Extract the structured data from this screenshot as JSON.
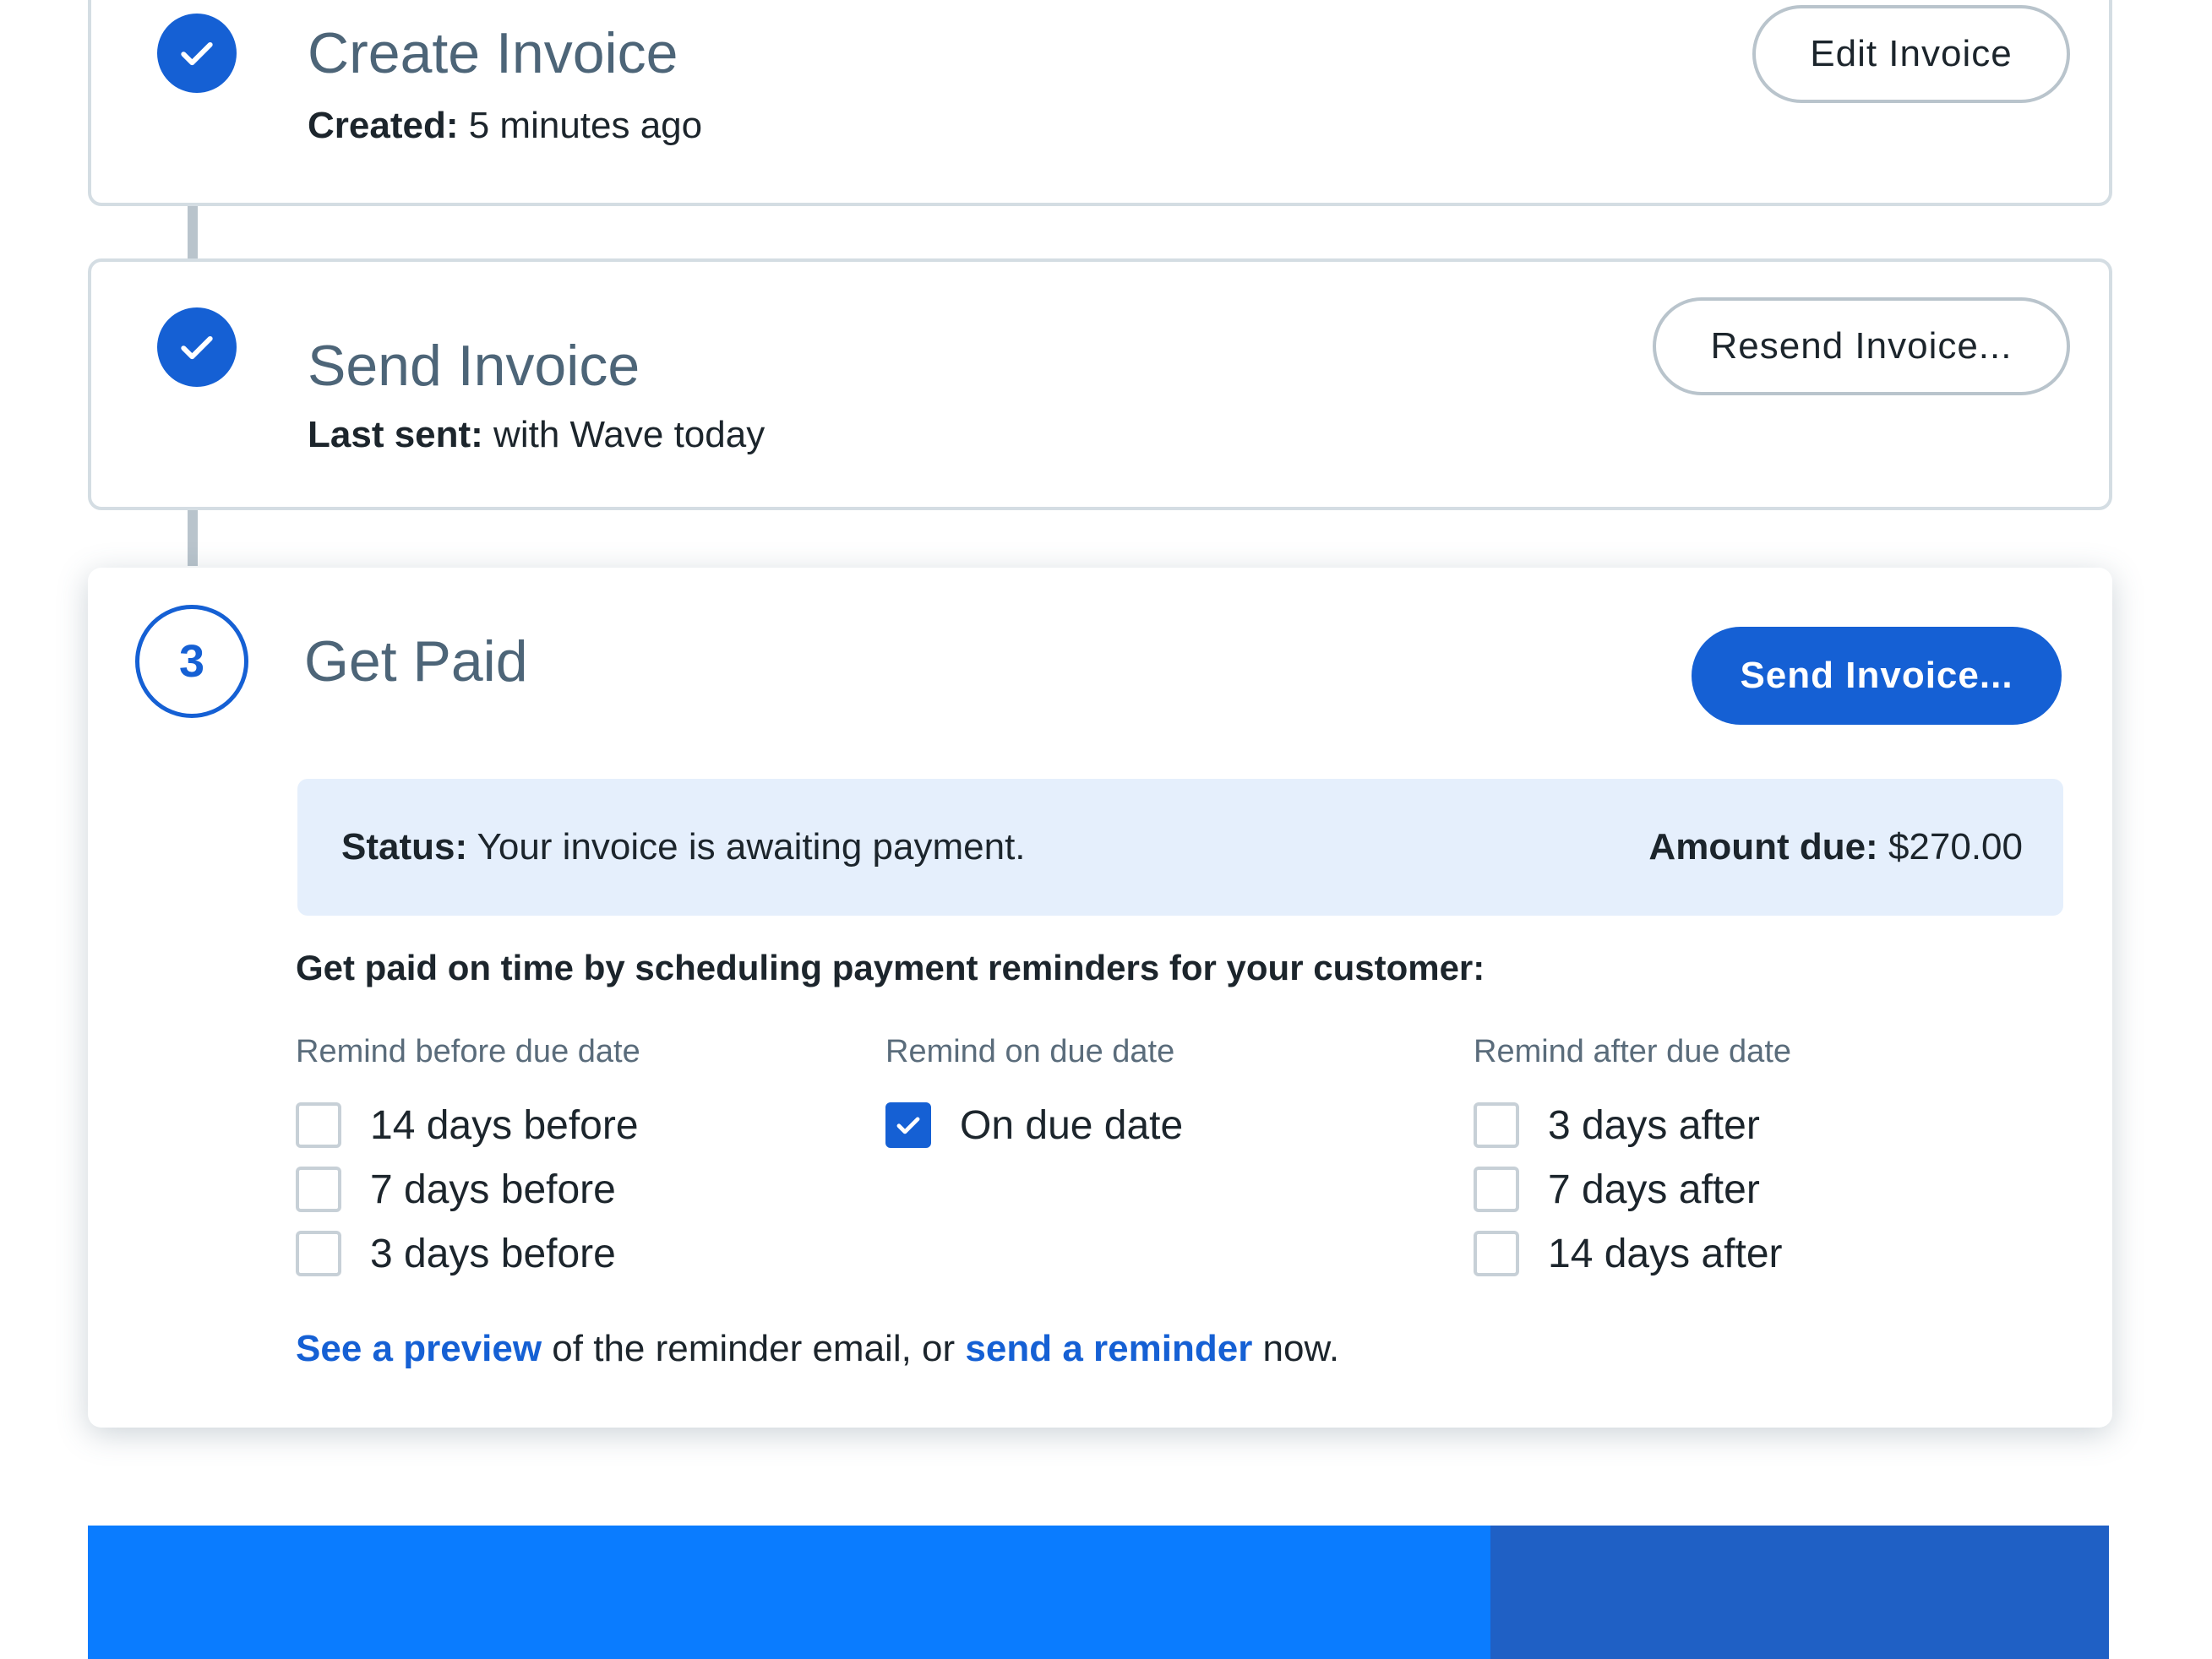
{
  "steps": [
    {
      "title": "Create Invoice",
      "meta_label": "Created:",
      "meta_value": " 5 minutes ago",
      "button": "Edit Invoice",
      "state": "complete"
    },
    {
      "title": "Send Invoice",
      "meta_label": "Last sent:",
      "meta_value": " with Wave today",
      "button": "Resend Invoice...",
      "state": "complete"
    },
    {
      "number": "3",
      "title": "Get Paid",
      "button": "Send Invoice...",
      "state": "active"
    }
  ],
  "status": {
    "label": "Status:",
    "text": " Your invoice is awaiting payment.",
    "amount_label": "Amount due:",
    "amount_value": " $270.00"
  },
  "reminders": {
    "heading": "Get paid on time by scheduling payment reminders for your customer:",
    "columns": [
      {
        "title": "Remind before due date",
        "options": [
          {
            "label": "14 days before",
            "checked": false
          },
          {
            "label": "7 days before",
            "checked": false
          },
          {
            "label": "3 days before",
            "checked": false
          }
        ]
      },
      {
        "title": "Remind on due date",
        "options": [
          {
            "label": "On due date",
            "checked": true
          }
        ]
      },
      {
        "title": "Remind after due date",
        "options": [
          {
            "label": "3 days after",
            "checked": false
          },
          {
            "label": "7 days after",
            "checked": false
          },
          {
            "label": "14 days after",
            "checked": false
          }
        ]
      }
    ]
  },
  "footer": {
    "preview_link": "See a preview",
    "middle_text": " of the reminder email, or ",
    "reminder_link": "send a reminder",
    "end_text": " now."
  },
  "colors": {
    "accent": "#1560d4",
    "status_bg": "#e5effc",
    "band_left": "#0a7cff",
    "band_right": "#1f60c5"
  }
}
